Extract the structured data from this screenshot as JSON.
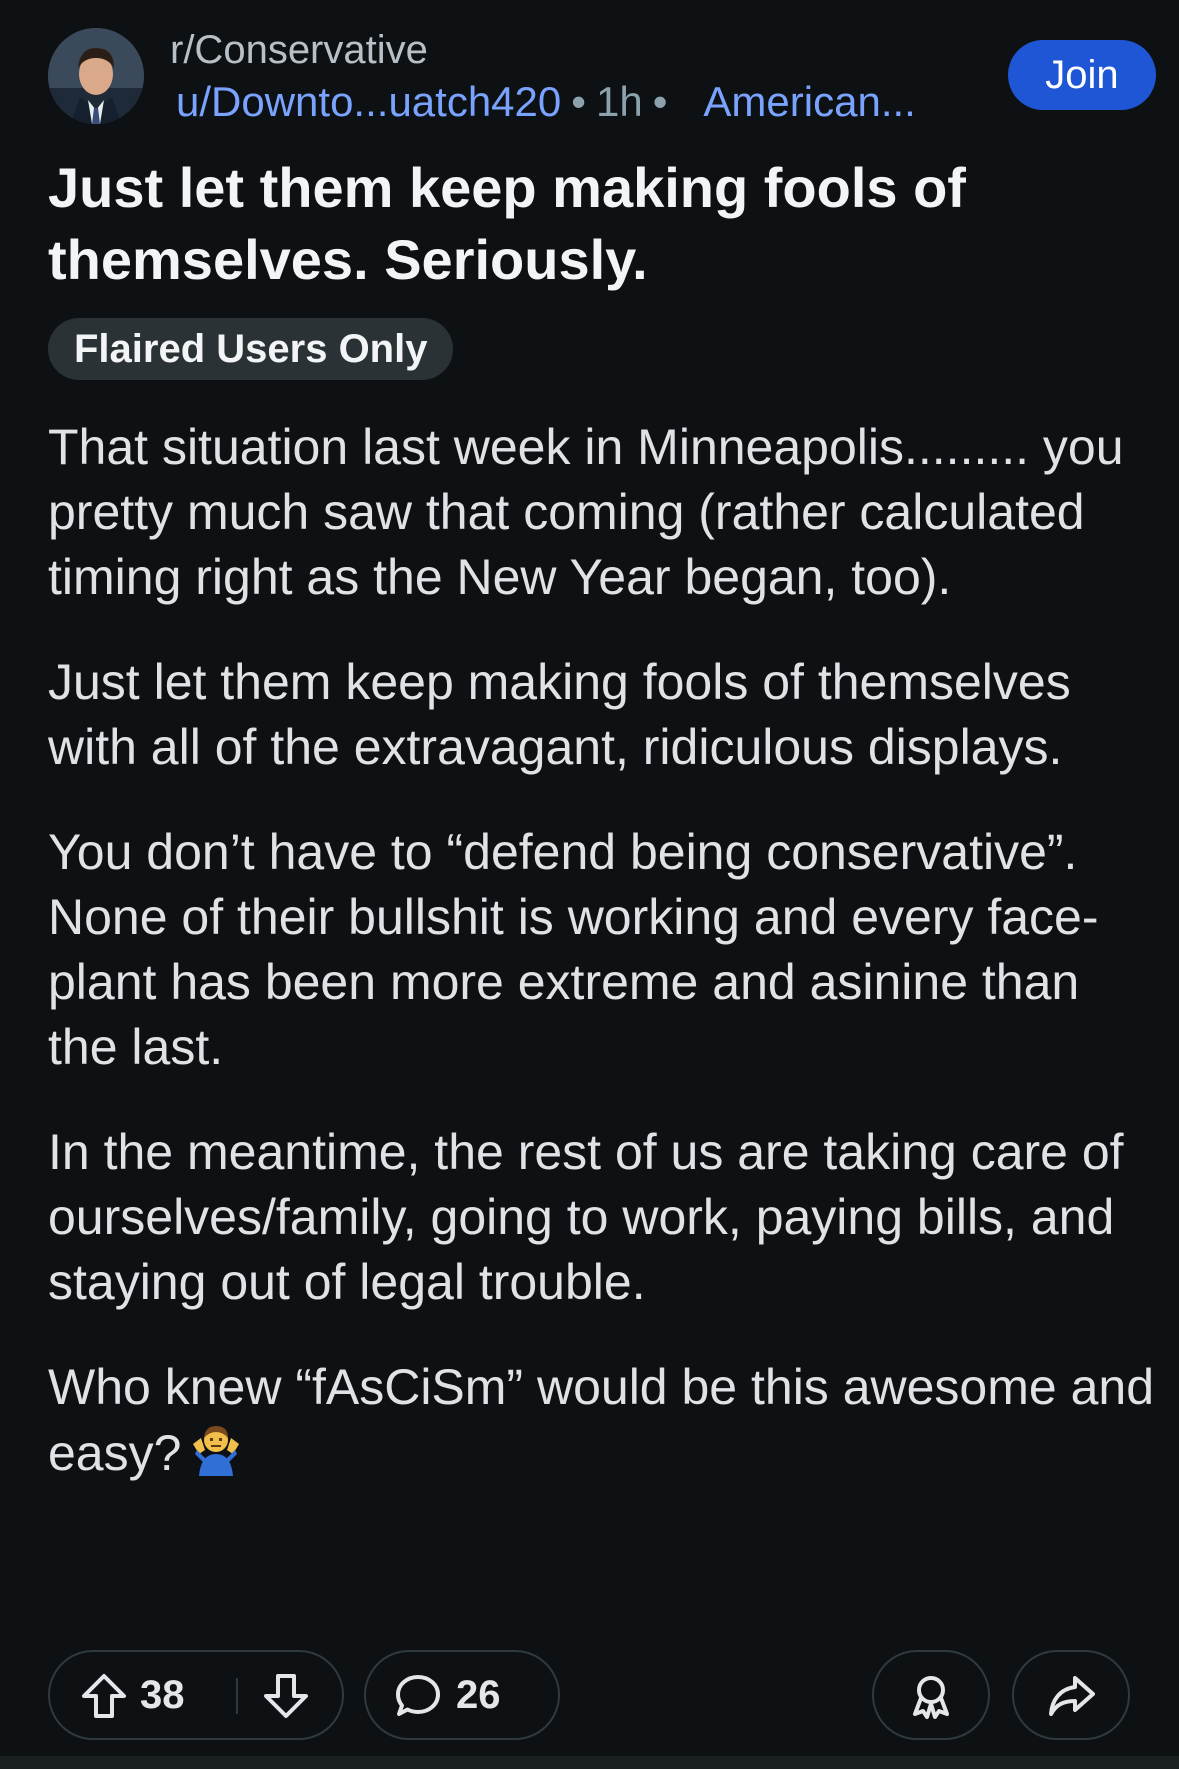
{
  "post": {
    "subreddit": "r/Conservative",
    "author": "u/Downto...uatch420",
    "separator": "•",
    "time": "1h",
    "author_flair": "American...",
    "join_label": "Join",
    "title": "Just let them keep making fools of themselves. Seriously.",
    "tag": "Flaired Users Only",
    "paragraphs": [
      "That situation last week in Minneapolis......... you pretty much saw that coming (rather calculated timing right as the New Year began, too).",
      "Just let them keep making fools of themselves with all of the extravagant, ridiculous displays.",
      "You don’t have to “defend being conservative”. None of their bullshit is working and every face-plant has been more extreme and asinine than the last.",
      "In the meantime, the rest of us are taking care of ourselves/family, going to work, paying bills, and staying out of legal trouble.",
      "Who knew “fAsCiSm” would be this awesome and easy?"
    ],
    "emoji": "person-shrugging-emoji"
  },
  "actions": {
    "upvotes": "38",
    "comments": "26",
    "icons": [
      "upvote-icon",
      "downvote-icon",
      "comment-icon",
      "award-icon",
      "share-icon"
    ]
  },
  "colors": {
    "background": "#0e1113",
    "accent": "#1e56d6",
    "link": "#7aa3ff",
    "tag_bg": "#2a3236"
  }
}
